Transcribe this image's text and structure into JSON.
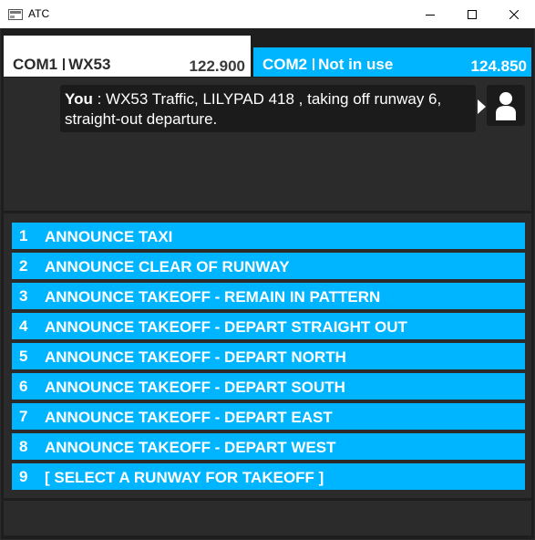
{
  "window": {
    "title": "ATC",
    "minimize_icon": "minimize-icon",
    "maximize_icon": "maximize-icon",
    "close_icon": "close-icon"
  },
  "com1": {
    "label": "COM1",
    "station": "WX53",
    "frequency": "122.900"
  },
  "com2": {
    "label": "COM2",
    "station": "Not in use",
    "frequency": "124.850"
  },
  "chat": {
    "speaker": "You",
    "separator": " : ",
    "message": "WX53 Traffic, LILYPAD 418 , taking off runway 6, straight-out departure.",
    "avatar_icon": "user-icon"
  },
  "menu": {
    "items": [
      {
        "number": "1",
        "label": "ANNOUNCE TAXI"
      },
      {
        "number": "2",
        "label": "ANNOUNCE CLEAR OF RUNWAY"
      },
      {
        "number": "3",
        "label": "ANNOUNCE TAKEOFF - REMAIN IN PATTERN"
      },
      {
        "number": "4",
        "label": "ANNOUNCE TAKEOFF - DEPART STRAIGHT OUT"
      },
      {
        "number": "5",
        "label": "ANNOUNCE TAKEOFF - DEPART NORTH"
      },
      {
        "number": "6",
        "label": "ANNOUNCE TAKEOFF - DEPART SOUTH"
      },
      {
        "number": "7",
        "label": "ANNOUNCE TAKEOFF - DEPART EAST"
      },
      {
        "number": "8",
        "label": "ANNOUNCE TAKEOFF - DEPART WEST"
      },
      {
        "number": "9",
        "label": "[ SELECT A RUNWAY FOR TAKEOFF ]"
      }
    ]
  },
  "colors": {
    "accent": "#00b5ff",
    "panel": "#2b2b2b",
    "background": "#1e1e1e"
  }
}
